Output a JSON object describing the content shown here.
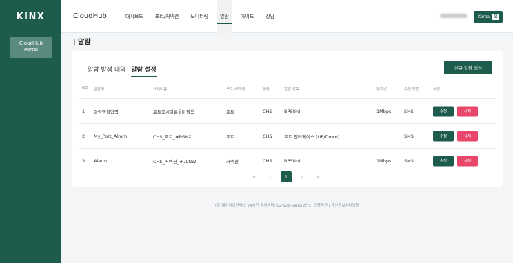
{
  "sidebar": {
    "logo": "KINX",
    "portal_line1": "CloudHub",
    "portal_line2": "Portal"
  },
  "topbar": {
    "brand": "CloudHub",
    "nav": [
      "대시보드",
      "포트/커넥션",
      "모니터링",
      "알람",
      "가이드",
      "상담"
    ],
    "active_nav": "알람",
    "language": "Korea",
    "language_icon": "globe-icon"
  },
  "page": {
    "title": "| 알람"
  },
  "tabs": {
    "history": "알람 발생 내역",
    "settings": "알람 설정",
    "active": "settings"
  },
  "new_alarm_button": "신규 알람 생성",
  "table": {
    "headers": {
      "no": "NO",
      "alarm_name": "알람명",
      "display_name": "표시이름",
      "port_conn": "포트/커넥션",
      "type": "종류",
      "item": "알람 항목",
      "threshold": "임계값",
      "method": "수신 방법",
      "action": "작업"
    },
    "rows": [
      {
        "no": "1",
        "alarm_name": "알람명을입력",
        "display_name": "포트표시이름을바꿨음",
        "port_conn": "포트",
        "type": "CHS",
        "item": "BPS(In)",
        "threshold": "1Mbps",
        "method": "SMS"
      },
      {
        "no": "2",
        "alarm_name": "My_Port_Alram",
        "display_name": "CHS_포트_#FGNX",
        "port_conn": "포트",
        "type": "CHS",
        "item": "포트 인터페이스 (UP/Down)",
        "threshold": "",
        "method": "SMS"
      },
      {
        "no": "3",
        "alarm_name": "Alarm",
        "display_name": "CHS_커넥션_#7LNW",
        "port_conn": "커넥션",
        "type": "CHS",
        "item": "BPS(In)",
        "threshold": "1Mbps",
        "method": "SMS"
      }
    ],
    "edit_label": "수정",
    "delete_label": "삭제"
  },
  "pagination": {
    "first": "«",
    "prev": "‹",
    "current": "1",
    "next": "›",
    "last": "»"
  },
  "footer": "(주)케이아이엔엑스  24시간 운영센터: 02-526-0900(2번)  |  이용약관  |  개인정보처리방침"
}
